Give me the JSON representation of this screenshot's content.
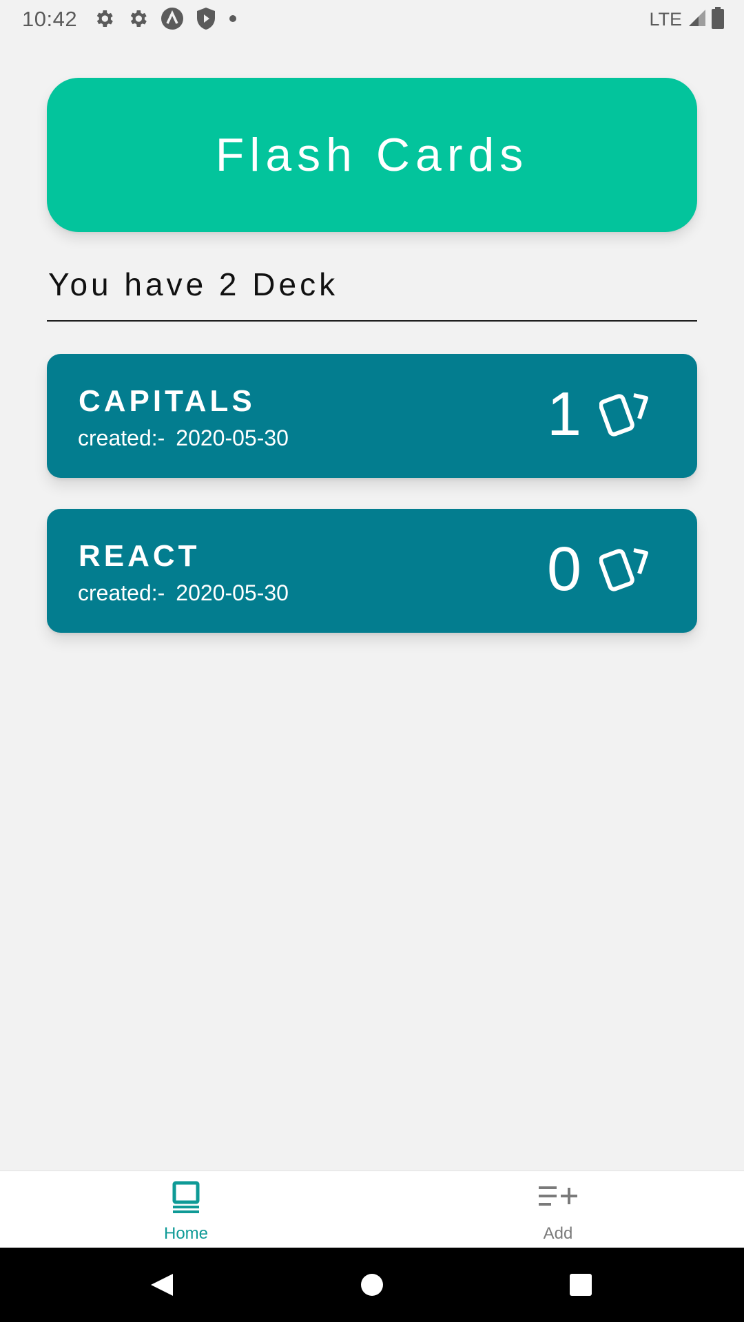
{
  "status_bar": {
    "time": "10:42",
    "network": "LTE",
    "icons": [
      "settings-icon",
      "settings-icon",
      "app-a-icon",
      "shield-icon",
      "dot-icon",
      "signal-icon",
      "battery-icon"
    ]
  },
  "header": {
    "title": "Flash Cards"
  },
  "summary": {
    "deck_count_text": "You have 2 Deck"
  },
  "decks": [
    {
      "name": "CAPITALS",
      "created_label": "created:-",
      "created_date": "2020-05-30",
      "card_count": "1",
      "icon": "cards-icon"
    },
    {
      "name": "REACT",
      "created_label": "created:-",
      "created_date": "2020-05-30",
      "card_count": "0",
      "icon": "cards-icon"
    }
  ],
  "tabs": [
    {
      "label": "Home",
      "icon": "home-icon",
      "active": true
    },
    {
      "label": "Add",
      "icon": "add-list-icon",
      "active": false
    }
  ],
  "colors": {
    "header_bg": "#03c49c",
    "deck_bg": "#037d8f",
    "tab_active": "#0e9a96",
    "tab_inactive": "#7a7a7a",
    "background": "#f2f2f2"
  }
}
